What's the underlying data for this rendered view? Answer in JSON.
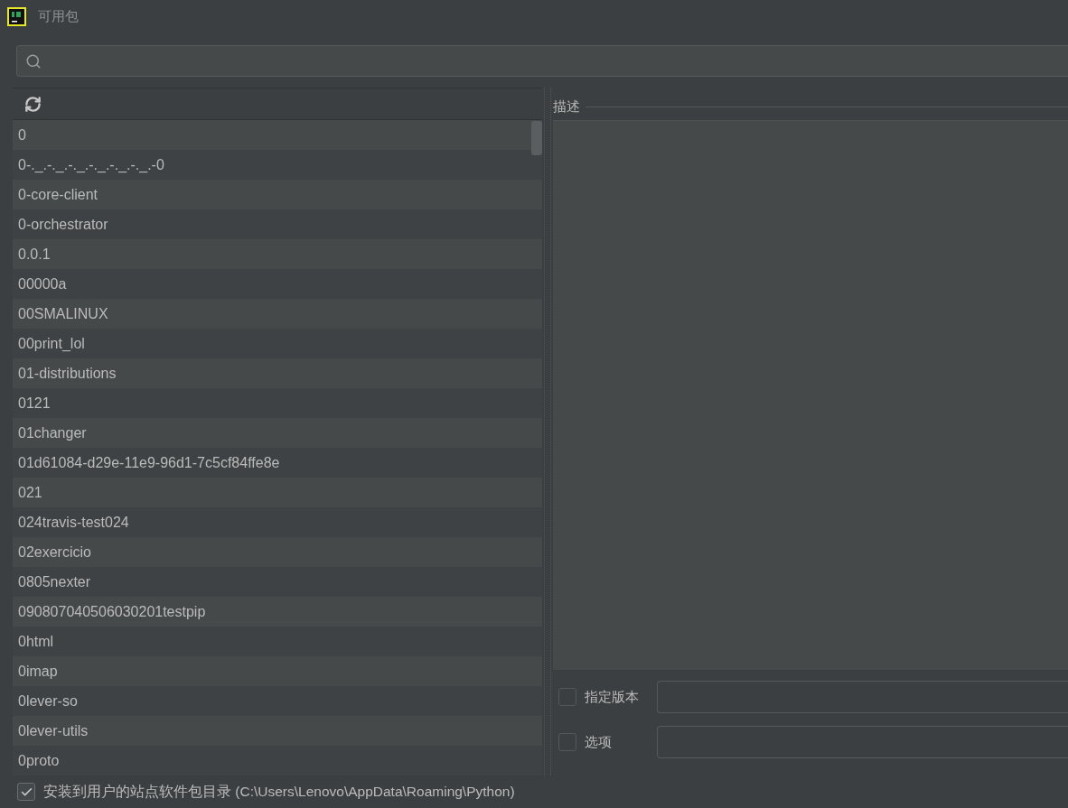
{
  "window": {
    "title": "可用包"
  },
  "packages": [
    "0",
    "0-._.-._.-._.-._.-._.-._.-0",
    "0-core-client",
    "0-orchestrator",
    "0.0.1",
    "00000a",
    "00SMALINUX",
    "00print_lol",
    "01-distributions",
    "0121",
    "01changer",
    "01d61084-d29e-11e9-96d1-7c5cf84ffe8e",
    "021",
    "024travis-test024",
    "02exercicio",
    "0805nexter",
    "090807040506030201testpip",
    "0html",
    "0imap",
    "0lever-so",
    "0lever-utils",
    "0proto"
  ],
  "description": {
    "title": "描述"
  },
  "options": [
    {
      "label": "指定版本",
      "checked": false
    },
    {
      "label": "选项",
      "checked": false
    }
  ],
  "install_to_user": {
    "label": "安装到用户的站点软件包目录 (C:\\Users\\Lenovo\\AppData\\Roaming\\Python)",
    "checked": true
  }
}
